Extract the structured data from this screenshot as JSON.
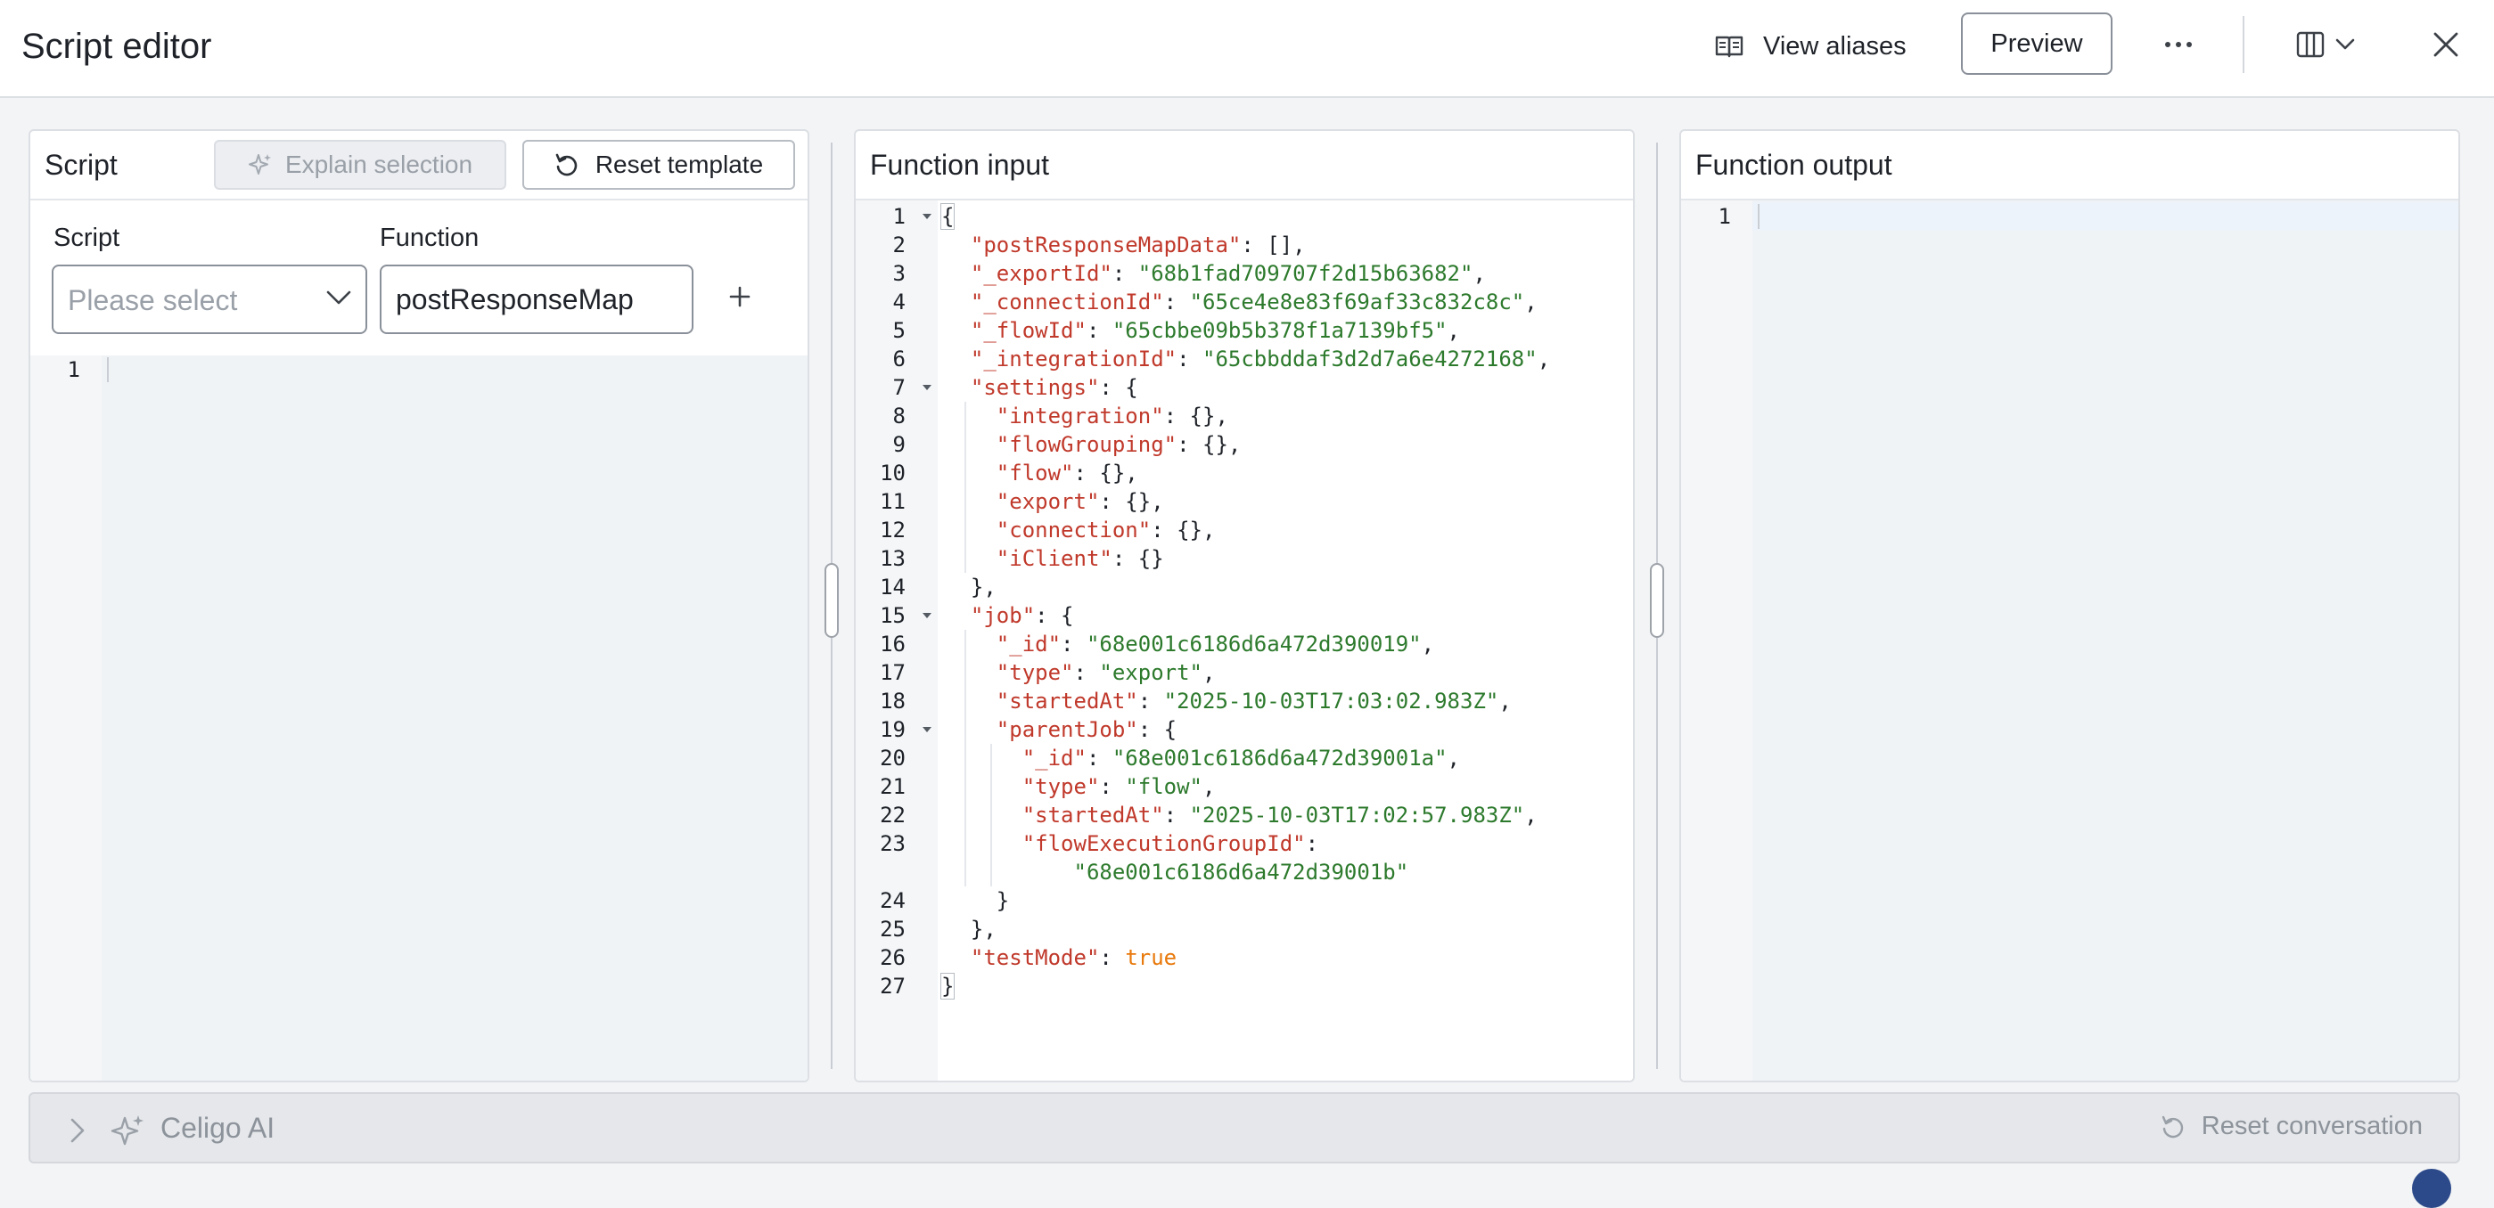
{
  "header": {
    "title": "Script editor",
    "view_aliases_label": "View aliases",
    "preview_label": "Preview"
  },
  "script_panel": {
    "title": "Script",
    "explain_label": "Explain selection",
    "reset_label": "Reset template",
    "script_field_label": "Script",
    "script_placeholder": "Please select",
    "function_field_label": "Function",
    "function_value": "postResponseMap",
    "line_numbers": [
      "1"
    ]
  },
  "input_panel": {
    "title": "Function input",
    "line_numbers": [
      "1",
      "2",
      "3",
      "4",
      "5",
      "6",
      "7",
      "8",
      "9",
      "10",
      "11",
      "12",
      "13",
      "14",
      "15",
      "16",
      "17",
      "18",
      "19",
      "20",
      "21",
      "22",
      "23",
      "",
      "24",
      "25",
      "26",
      "27"
    ],
    "code": {
      "l2_key": "\"postResponseMapData\"",
      "l2_rest": ": [],",
      "l3_key": "\"_exportId\"",
      "l3_val": "\"68b1fad709707f2d15b63682\"",
      "l4_key": "\"_connectionId\"",
      "l4_val": "\"65ce4e8e83f69af33c832c8c\"",
      "l5_key": "\"_flowId\"",
      "l5_val": "\"65cbbe09b5b378f1a7139bf5\"",
      "l6_key": "\"_integrationId\"",
      "l6_val": "\"65cbbddaf3d2d7a6e4272168\"",
      "l7_key": "\"settings\"",
      "l8_key": "\"integration\"",
      "l9_key": "\"flowGrouping\"",
      "l10_key": "\"flow\"",
      "l11_key": "\"export\"",
      "l12_key": "\"connection\"",
      "l13_key": "\"iClient\"",
      "l15_key": "\"job\"",
      "l16_key": "\"_id\"",
      "l16_val": "\"68e001c6186d6a472d390019\"",
      "l17_key": "\"type\"",
      "l17_val": "\"export\"",
      "l18_key": "\"startedAt\"",
      "l18_val": "\"2025-10-03T17:03:02.983Z\"",
      "l19_key": "\"parentJob\"",
      "l20_key": "\"_id\"",
      "l20_val": "\"68e001c6186d6a472d39001a\"",
      "l21_key": "\"type\"",
      "l21_val": "\"flow\"",
      "l22_key": "\"startedAt\"",
      "l22_val": "\"2025-10-03T17:02:57.983Z\"",
      "l23_key": "\"flowExecutionGroupId\"",
      "l23_val": "\"68e001c6186d6a472d39001b\"",
      "l26_key": "\"testMode\"",
      "l26_val": "true"
    }
  },
  "output_panel": {
    "title": "Function output",
    "line_numbers": [
      "1"
    ]
  },
  "ai_bar": {
    "label": "Celigo AI",
    "reset_label": "Reset conversation"
  }
}
